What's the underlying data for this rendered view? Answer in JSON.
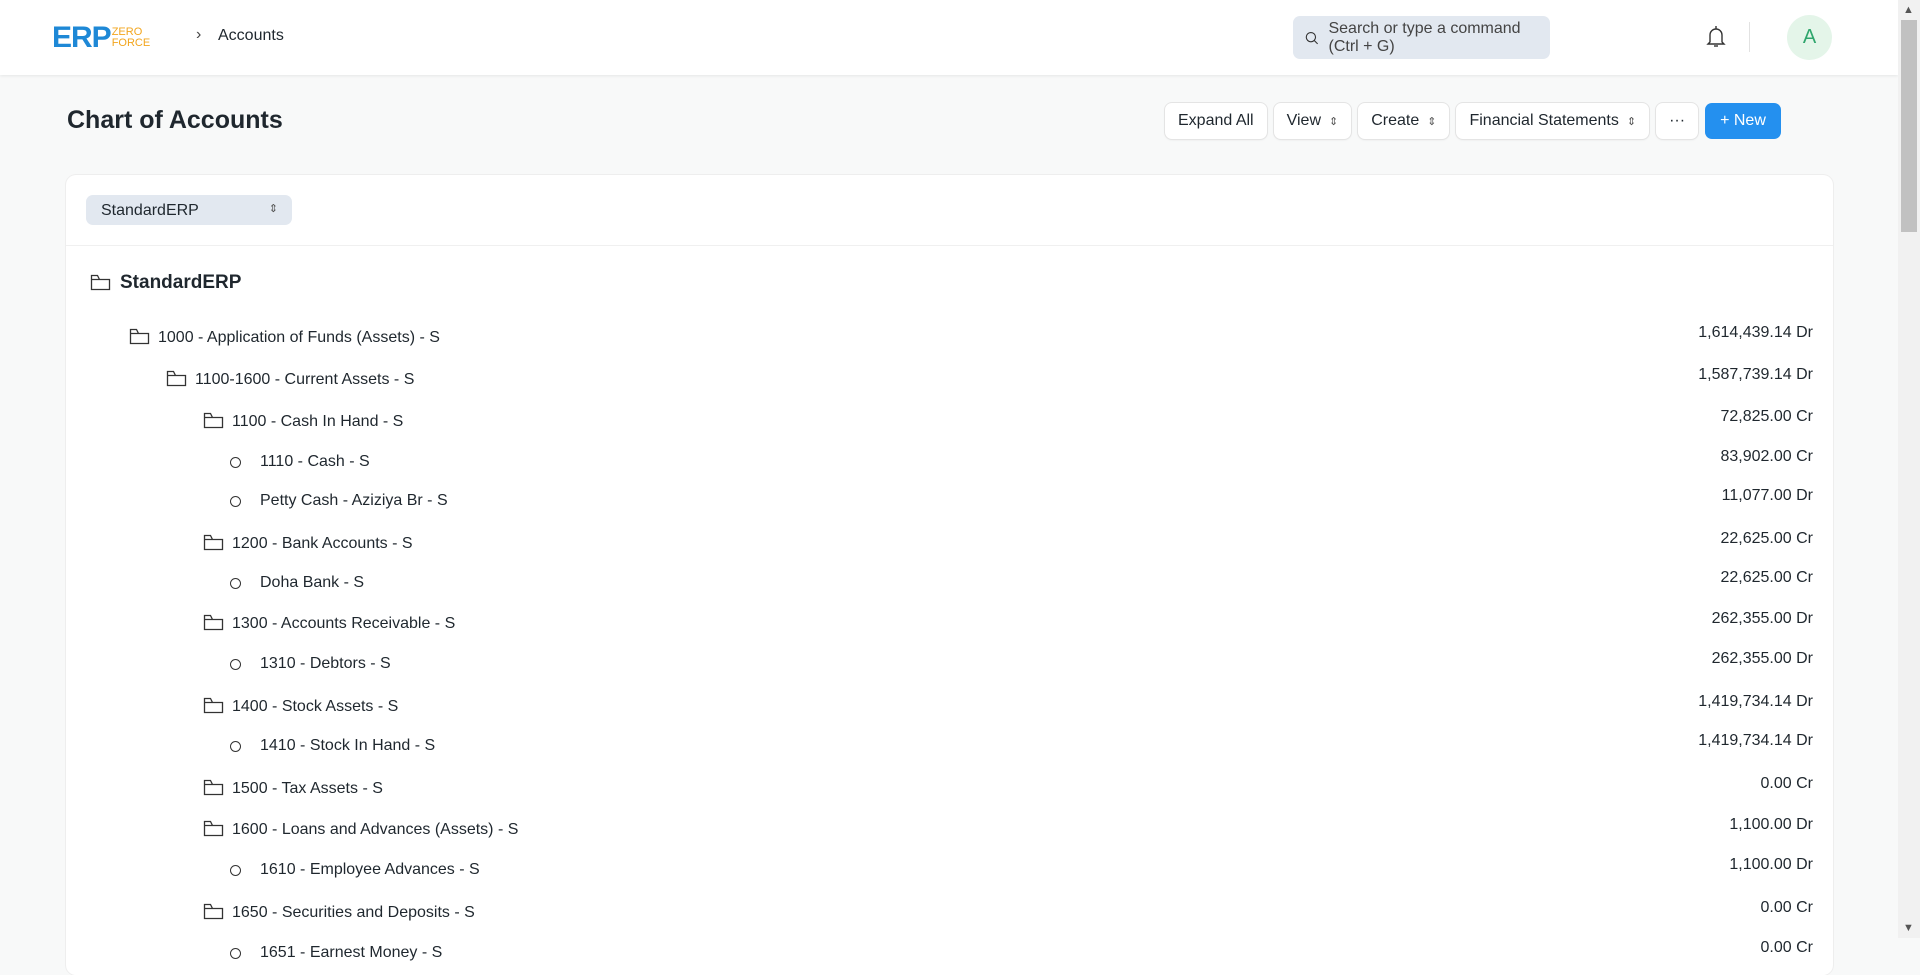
{
  "header": {
    "logo_main": "ERP",
    "logo_sub1": "ZERO",
    "logo_sub2": "FORCE",
    "breadcrumb": "Accounts",
    "search_placeholder": "Search or type a command (Ctrl + G)",
    "avatar_initial": "A"
  },
  "page": {
    "title": "Chart of Accounts"
  },
  "toolbar": {
    "expand_all": "Expand All",
    "view": "View",
    "create": "Create",
    "financial_statements": "Financial Statements",
    "more": "···",
    "new": "+ New"
  },
  "company_select": "StandardERP",
  "tree": [
    {
      "level": 0,
      "type": "group",
      "label": "StandardERP",
      "amount": ""
    },
    {
      "level": 1,
      "type": "group",
      "label": "1000 - Application of Funds (Assets) - S",
      "amount": "1,614,439.14 Dr"
    },
    {
      "level": 2,
      "type": "group",
      "label": "1100-1600 - Current Assets - S",
      "amount": "1,587,739.14 Dr"
    },
    {
      "level": 3,
      "type": "group",
      "label": "1100 - Cash In Hand - S",
      "amount": "72,825.00 Cr"
    },
    {
      "level": 4,
      "type": "leaf",
      "label": "1110 - Cash - S",
      "amount": "83,902.00 Cr"
    },
    {
      "level": 4,
      "type": "leaf",
      "label": "Petty Cash - Aziziya Br - S",
      "amount": "11,077.00 Dr"
    },
    {
      "level": 3,
      "type": "group",
      "label": "1200 - Bank Accounts - S",
      "amount": "22,625.00 Cr"
    },
    {
      "level": 4,
      "type": "leaf",
      "label": "Doha Bank - S",
      "amount": "22,625.00 Cr"
    },
    {
      "level": 3,
      "type": "group",
      "label": "1300 - Accounts Receivable - S",
      "amount": "262,355.00 Dr"
    },
    {
      "level": 4,
      "type": "leaf",
      "label": "1310 - Debtors - S",
      "amount": "262,355.00 Dr"
    },
    {
      "level": 3,
      "type": "group",
      "label": "1400 - Stock Assets - S",
      "amount": "1,419,734.14 Dr"
    },
    {
      "level": 4,
      "type": "leaf",
      "label": "1410 - Stock In Hand - S",
      "amount": "1,419,734.14 Dr"
    },
    {
      "level": 3,
      "type": "group",
      "label": "1500 - Tax Assets - S",
      "amount": "0.00 Cr"
    },
    {
      "level": 3,
      "type": "group",
      "label": "1600 - Loans and Advances (Assets) - S",
      "amount": "1,100.00 Dr"
    },
    {
      "level": 4,
      "type": "leaf",
      "label": "1610 - Employee Advances - S",
      "amount": "1,100.00 Dr"
    },
    {
      "level": 3,
      "type": "group",
      "label": "1650 - Securities and Deposits - S",
      "amount": "0.00 Cr"
    },
    {
      "level": 4,
      "type": "leaf",
      "label": "1651 - Earnest Money - S",
      "amount": "0.00 Cr"
    }
  ]
}
